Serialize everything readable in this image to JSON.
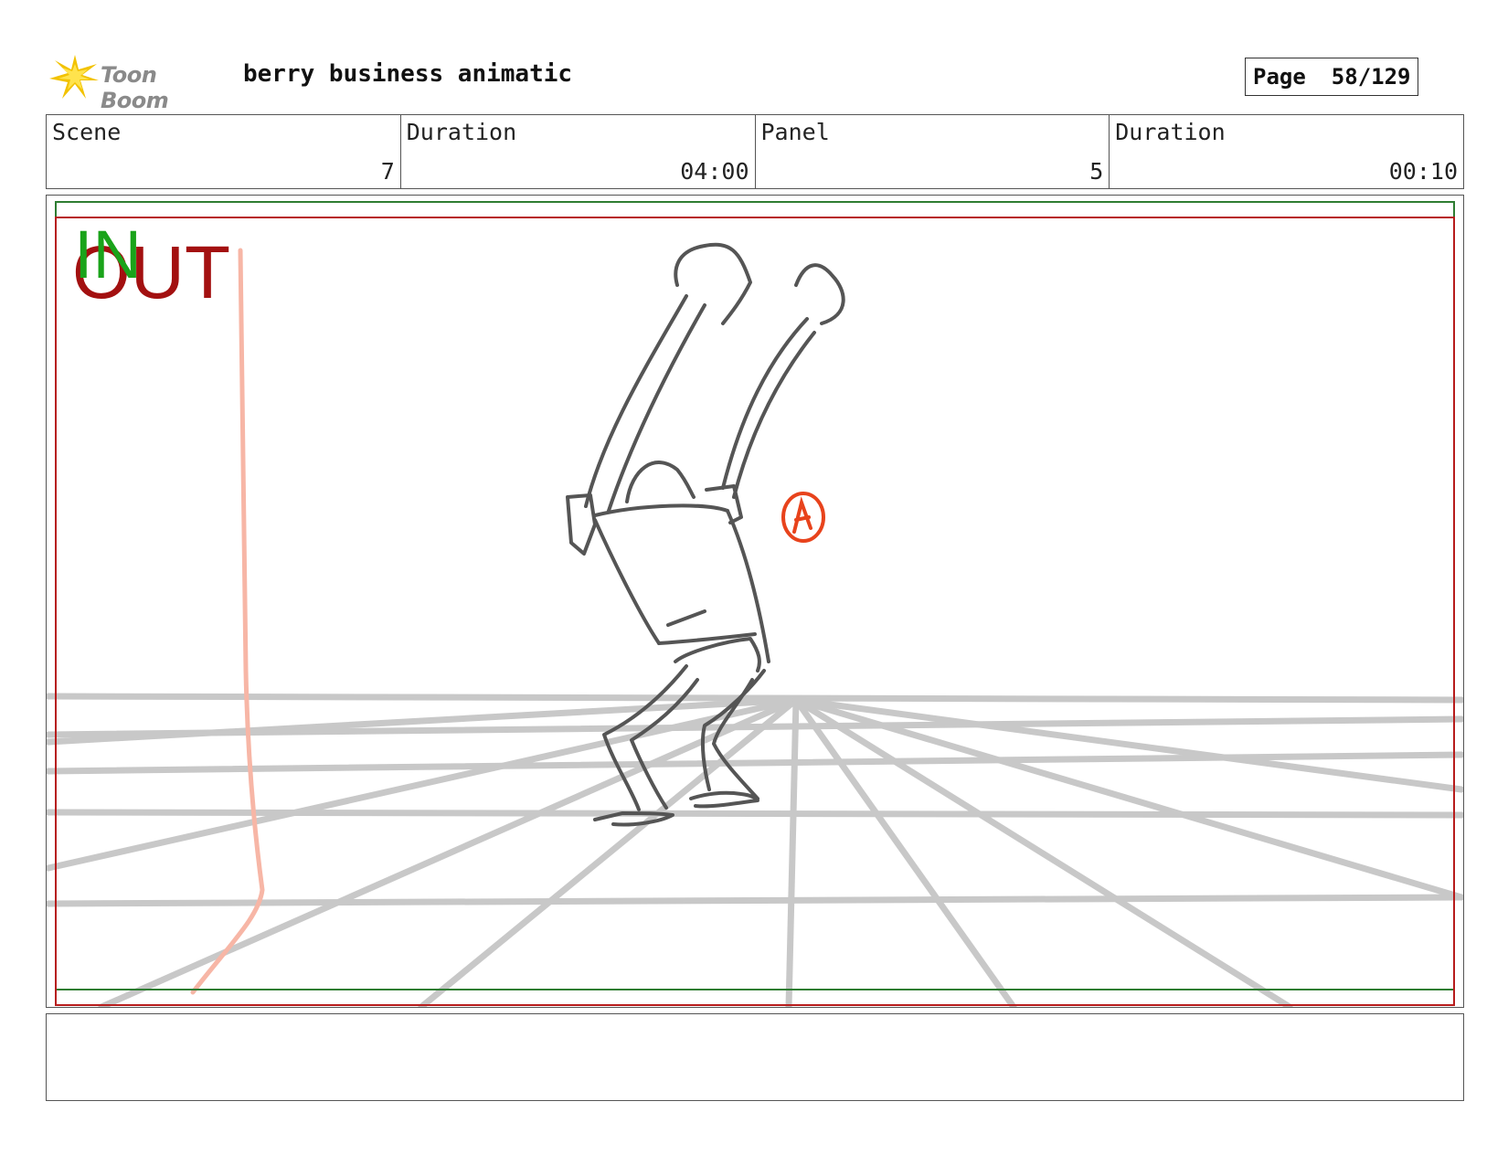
{
  "header": {
    "logo_text": "Toon Boom",
    "project_title": "berry business animatic",
    "page_label": "Page",
    "page_number": "58/129"
  },
  "info": {
    "scene_label": "Scene",
    "scene_value": "7",
    "scene_duration_label": "Duration",
    "scene_duration_value": "04:00",
    "panel_label": "Panel",
    "panel_value": "5",
    "panel_duration_label": "Duration",
    "panel_duration_value": "00:10"
  },
  "panel": {
    "in_label": "IN",
    "out_label": "OUT",
    "circle_mark": "A"
  },
  "colors": {
    "in_color": "#1aa31a",
    "out_color": "#a31010",
    "guide_green": "#2e7d32",
    "guide_red": "#b71c1c",
    "sketch": "#555555",
    "perspective_grid": "#c8c8c8",
    "annotation": "#e8431c"
  },
  "notes": {
    "text": ""
  }
}
